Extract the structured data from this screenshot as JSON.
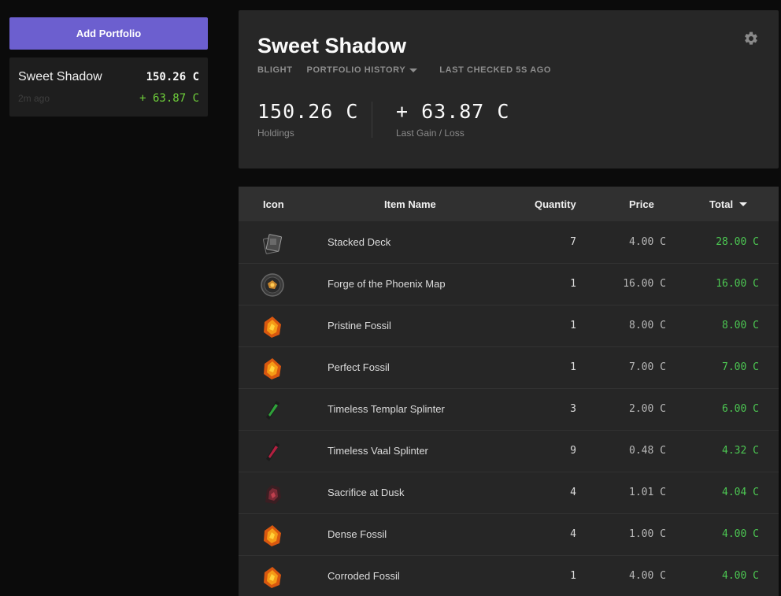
{
  "sidebar": {
    "add_button": "Add Portfolio",
    "portfolio": {
      "name": "Sweet Shadow",
      "value": "150.26 C",
      "time": "2m ago",
      "gain": "+ 63.87 C"
    }
  },
  "header": {
    "title": "Sweet Shadow",
    "league": "BLIGHT",
    "history_label": "PORTFOLIO HISTORY",
    "last_checked": "LAST CHECKED 5S AGO",
    "holdings_value": "150.26 C",
    "holdings_label": "Holdings",
    "gain_value": "+ 63.87 C",
    "gain_label": "Last Gain / Loss"
  },
  "table": {
    "columns": {
      "icon": "Icon",
      "name": "Item Name",
      "quantity": "Quantity",
      "price": "Price",
      "total": "Total"
    },
    "rows": [
      {
        "icon": "stacked-deck-icon",
        "name": "Stacked Deck",
        "qty": "7",
        "price": "4.00 C",
        "total": "28.00 C"
      },
      {
        "icon": "map-icon",
        "name": "Forge of the Phoenix Map",
        "qty": "1",
        "price": "16.00 C",
        "total": "16.00 C"
      },
      {
        "icon": "fossil-icon",
        "name": "Pristine Fossil",
        "qty": "1",
        "price": "8.00 C",
        "total": "8.00 C"
      },
      {
        "icon": "fossil-icon",
        "name": "Perfect Fossil",
        "qty": "1",
        "price": "7.00 C",
        "total": "7.00 C"
      },
      {
        "icon": "splinter-green-icon",
        "name": "Timeless Templar Splinter",
        "qty": "3",
        "price": "2.00 C",
        "total": "6.00 C"
      },
      {
        "icon": "splinter-red-icon",
        "name": "Timeless Vaal Splinter",
        "qty": "9",
        "price": "0.48 C",
        "total": "4.32 C"
      },
      {
        "icon": "fragment-icon",
        "name": "Sacrifice at Dusk",
        "qty": "4",
        "price": "1.01 C",
        "total": "4.04 C"
      },
      {
        "icon": "fossil-icon",
        "name": "Dense Fossil",
        "qty": "4",
        "price": "1.00 C",
        "total": "4.00 C"
      },
      {
        "icon": "fossil-icon",
        "name": "Corroded Fossil",
        "qty": "1",
        "price": "4.00 C",
        "total": "4.00 C"
      }
    ]
  },
  "colors": {
    "accent": "#6c5fcf",
    "gain": "#6fd13b",
    "total": "#4cc752",
    "background": "#0b0b0b",
    "panel": "#272727"
  }
}
